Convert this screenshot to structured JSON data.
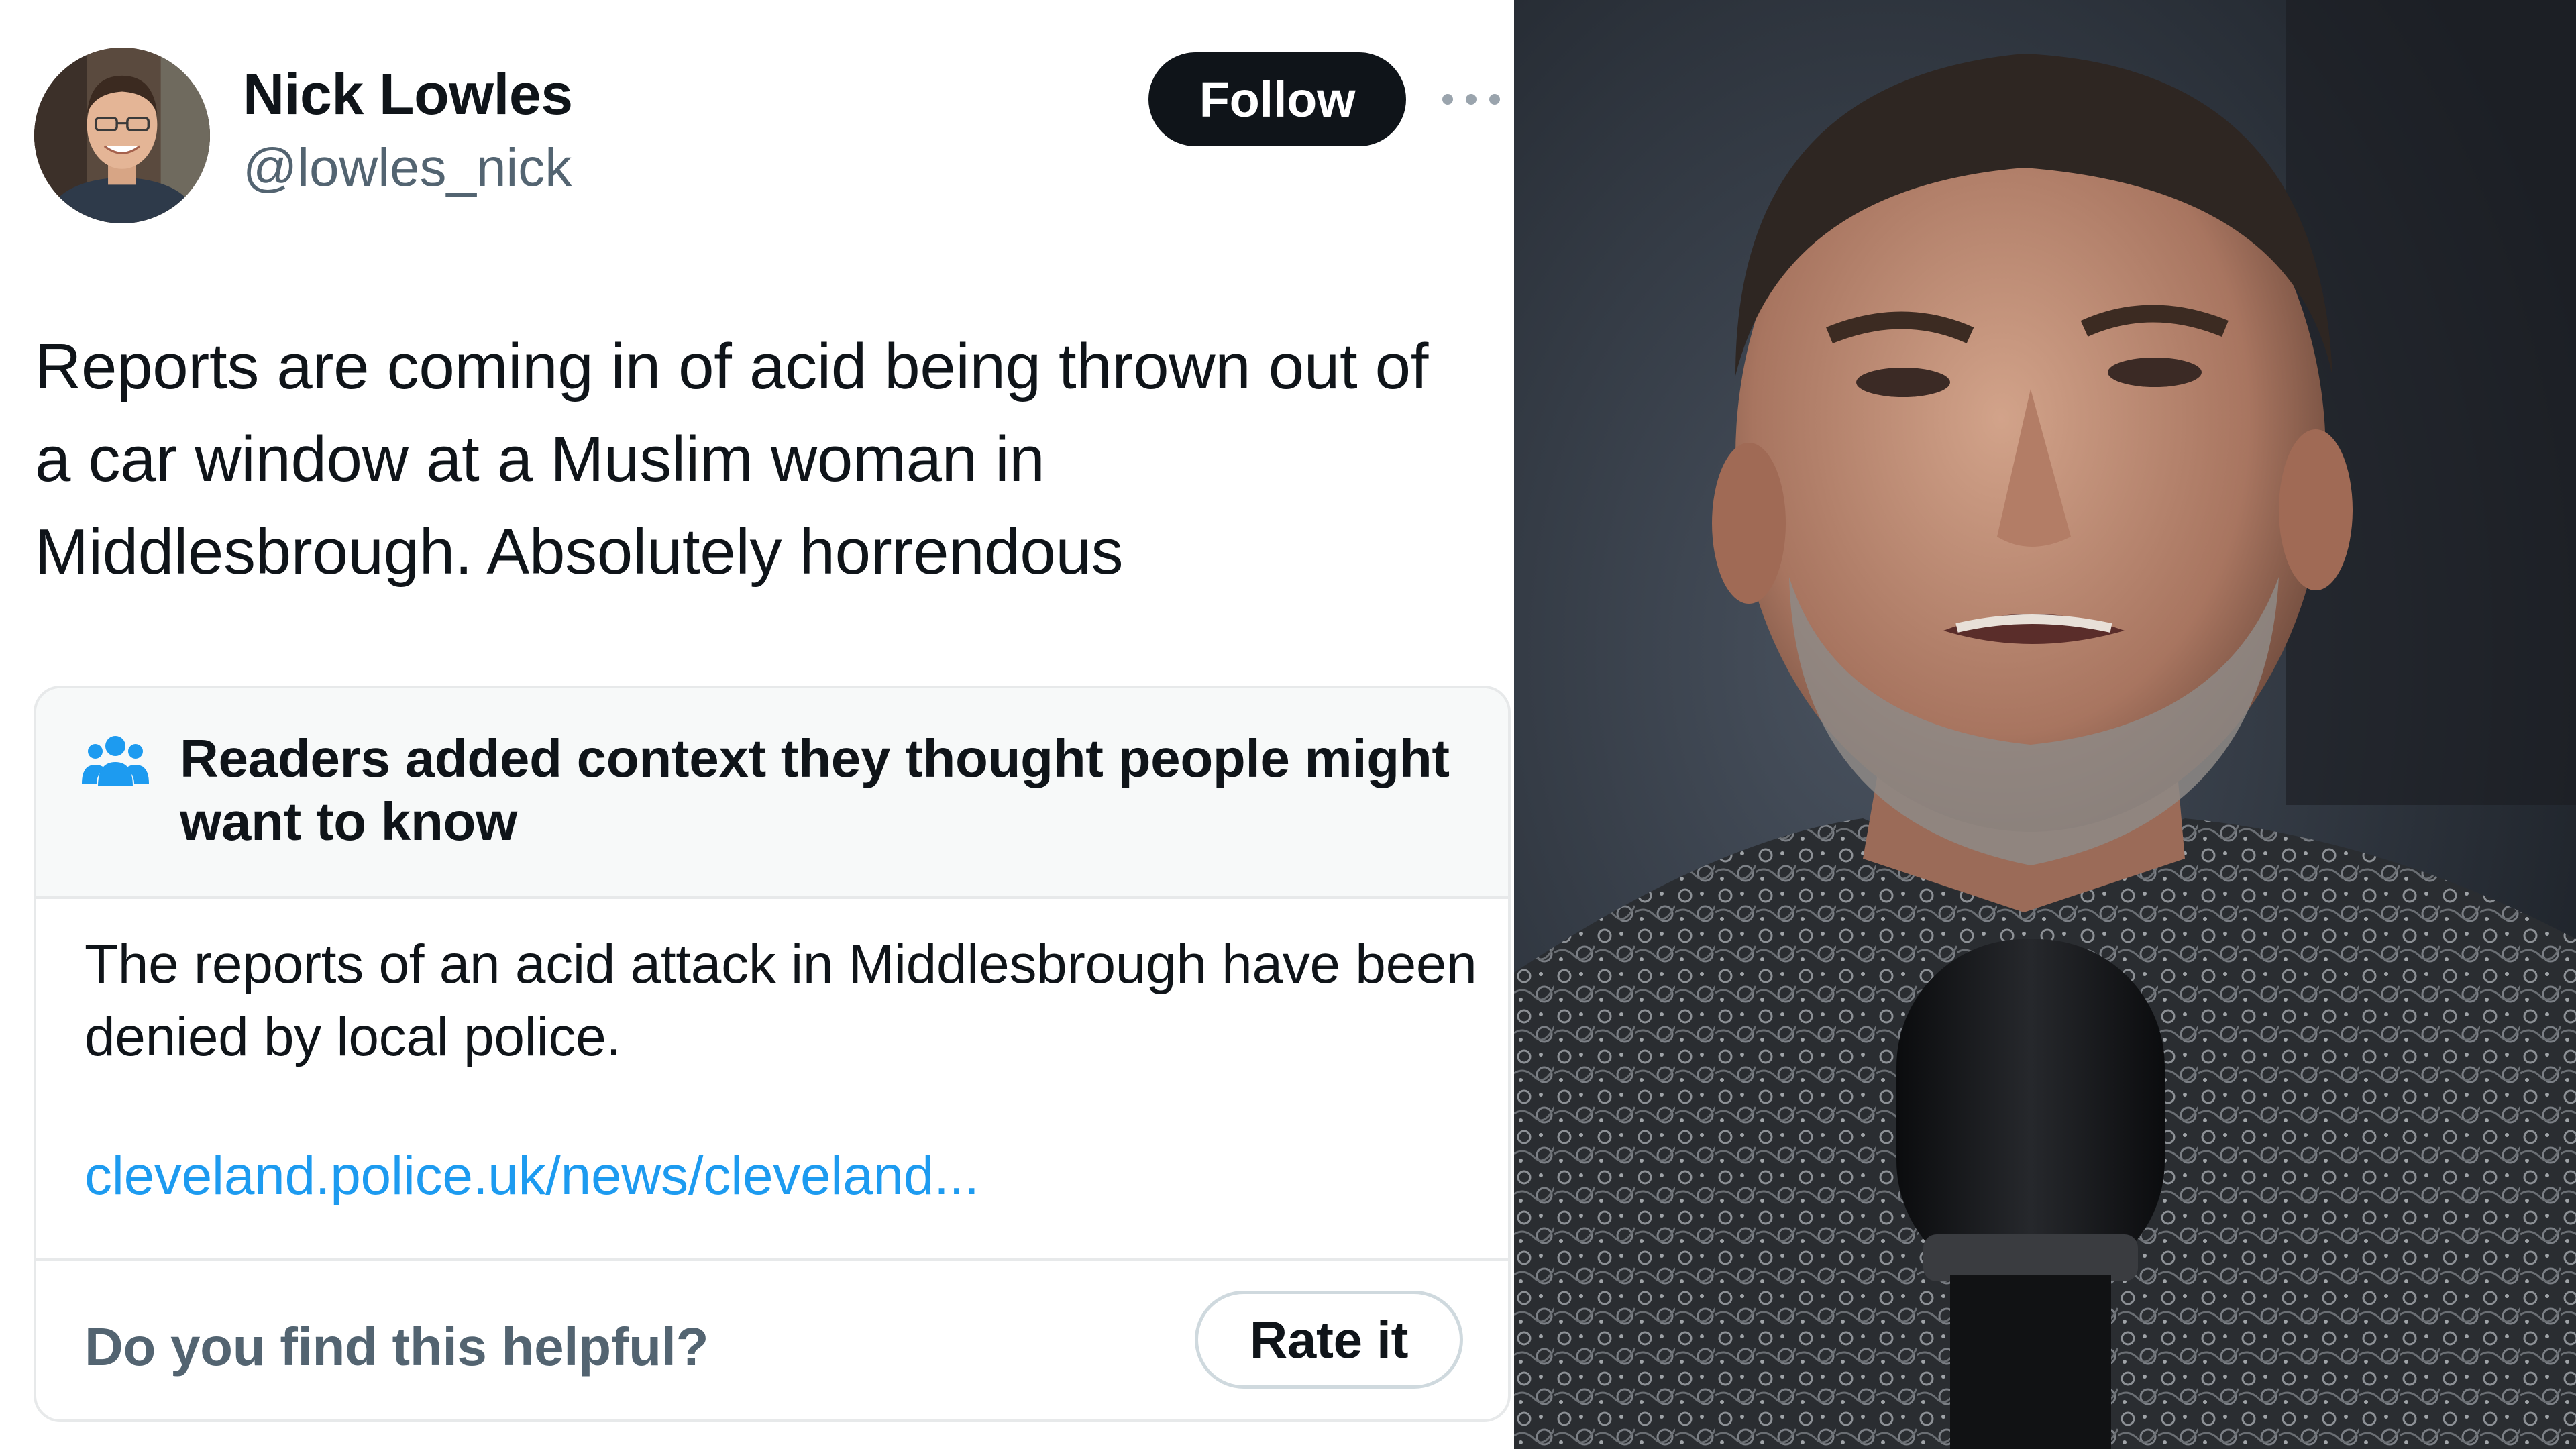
{
  "tweet": {
    "author_name": "Nick Lowles",
    "author_handle": "@lowles_nick",
    "follow_label": "Follow",
    "more_icon": "more-horizontal-icon",
    "text": "Reports are coming in of acid being thrown out of a car window at a Muslim woman in Middlesbrough. Absolutely horrendous"
  },
  "community_note": {
    "icon": "people-icon",
    "title": "Readers added context they thought people might want to know",
    "body": "The reports of an acid attack in Middlesbrough have been denied by local police.",
    "link": "cleveland.police.uk/news/cleveland...",
    "question": "Do you find this helpful?",
    "rate_label": "Rate it"
  },
  "colors": {
    "text_primary": "#0f1419",
    "text_secondary": "#536471",
    "link": "#1d9bf0",
    "follow_bg": "#0f1419",
    "border": "#e7e9ea",
    "note_header_bg": "#f7f9f9"
  }
}
